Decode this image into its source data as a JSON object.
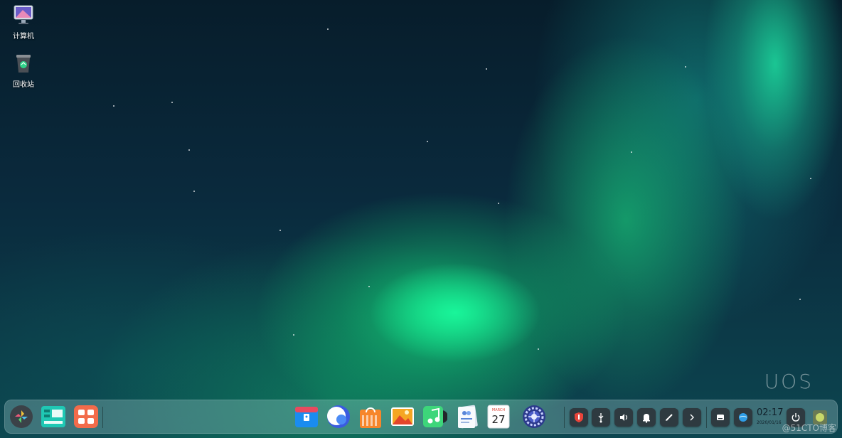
{
  "desktop": {
    "icons": [
      {
        "label": "计算机",
        "icon": "computer-icon"
      },
      {
        "label": "回收站",
        "icon": "trash-icon"
      }
    ],
    "brand_text": "UOS",
    "watermark": "@51CTO博客"
  },
  "dock": {
    "left_items": [
      {
        "name": "launcher-button",
        "icon": "launcher-icon"
      },
      {
        "name": "multitask-view-button",
        "icon": "multitask-icon"
      },
      {
        "name": "window-switch-button",
        "icon": "workspace-icon"
      }
    ],
    "apps": [
      {
        "name": "app-file-manager",
        "icon": "file-manager-icon"
      },
      {
        "name": "app-browser",
        "icon": "browser-icon"
      },
      {
        "name": "app-store",
        "icon": "store-bag-icon"
      },
      {
        "name": "app-photos",
        "icon": "photos-icon"
      },
      {
        "name": "app-music",
        "icon": "music-icon"
      },
      {
        "name": "app-contacts",
        "icon": "contacts-icon"
      },
      {
        "name": "app-calendar",
        "icon": "calendar-icon",
        "month": "MARCH",
        "day": "27"
      },
      {
        "name": "app-control-center",
        "icon": "gear-icon"
      }
    ],
    "tray": [
      {
        "name": "tray-antivirus",
        "icon": "shield-icon"
      },
      {
        "name": "tray-usb",
        "icon": "usb-icon"
      },
      {
        "name": "tray-volume",
        "icon": "volume-icon"
      },
      {
        "name": "tray-notifications",
        "icon": "bell-icon"
      },
      {
        "name": "tray-input",
        "icon": "pen-icon"
      },
      {
        "name": "tray-expand",
        "icon": "chevron-right-icon"
      },
      {
        "name": "tray-keyboard",
        "icon": "keyboard-icon"
      },
      {
        "name": "tray-network",
        "icon": "network-icon"
      }
    ],
    "clock": {
      "time": "02:17",
      "date": "2020/01/16"
    },
    "power_icon": "power-icon",
    "show_desktop_icon": "show-desktop-icon"
  },
  "colors": {
    "accent": "#1ee6a0",
    "dock_bg": "#bfe6e6"
  }
}
